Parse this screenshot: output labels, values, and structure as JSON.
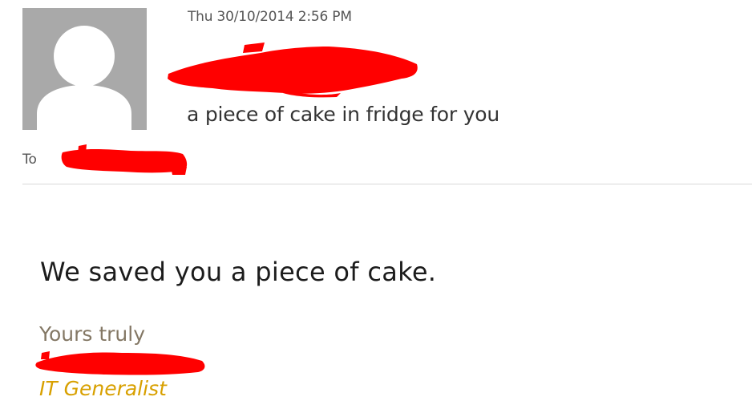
{
  "message": {
    "timestamp": "Thu 30/10/2014 2:56 PM",
    "subject": "a piece of cake in fridge for you",
    "to_label": "To",
    "body": "We saved you a piece of cake.",
    "signature": {
      "signoff": "Yours truly",
      "title": "IT Generalist"
    }
  },
  "icons": {
    "avatar": "default-person-avatar-icon"
  },
  "colors": {
    "avatar_background": "#a9a9a9",
    "redaction": "#ff0000",
    "signoff_text": "#837764",
    "signature_title": "#d8a000"
  }
}
